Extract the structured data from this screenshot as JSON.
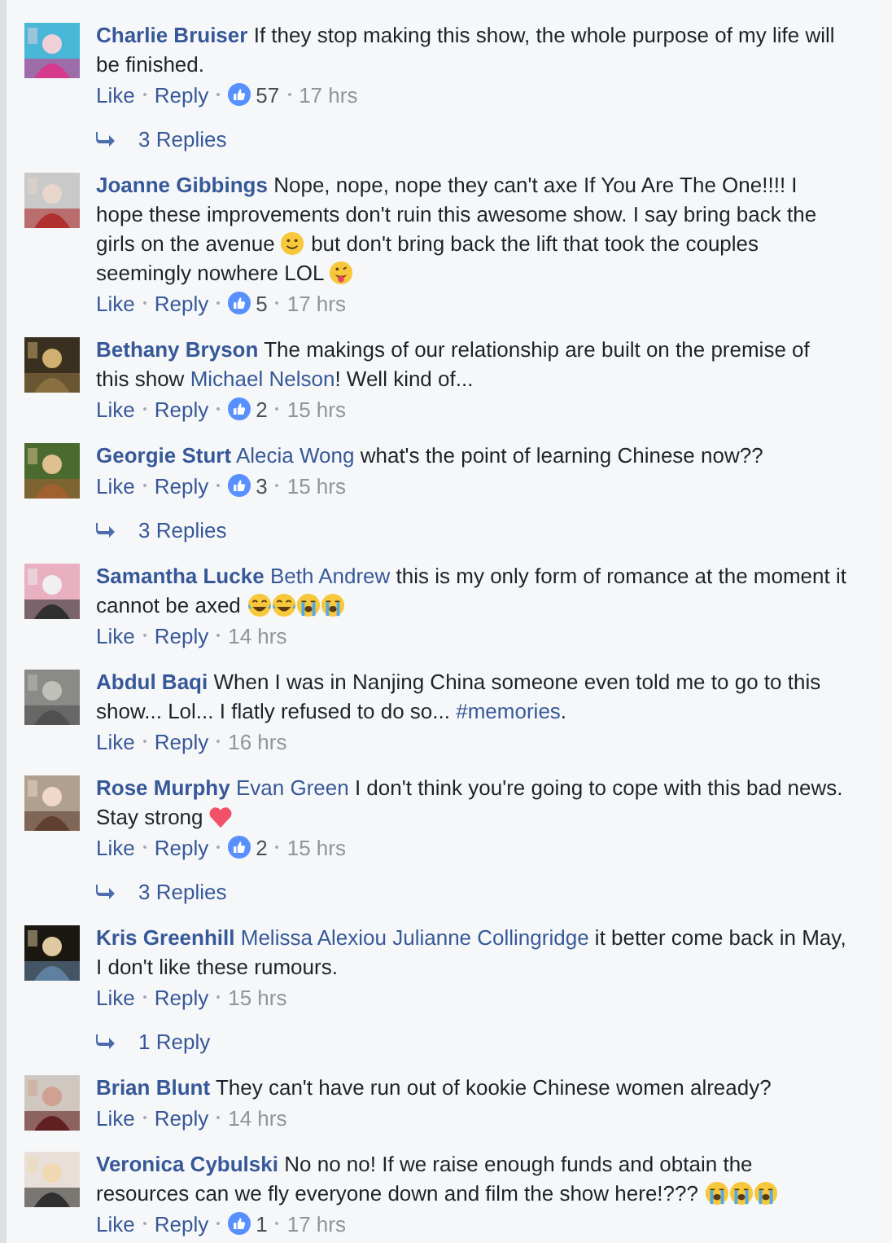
{
  "comments": [
    {
      "author": "Charlie Bruiser",
      "body": [
        {
          "kind": "text",
          "text": "If they stop making this show, the whole purpose of my life will be finished."
        }
      ],
      "actions": [
        "Like",
        "Reply"
      ],
      "likes": "57",
      "time": "17 hrs",
      "replies": "3 Replies"
    },
    {
      "author": "Joanne Gibbings",
      "body": [
        {
          "kind": "text",
          "text": "Nope, nope, nope they can't axe If You Are The One!!!! I hope these improvements don't ruin this awesome show. I say bring back the girls on the avenue "
        },
        {
          "kind": "smile"
        },
        {
          "kind": "text",
          "text": " but don't bring back the lift that took the couples seemingly nowhere LOL "
        },
        {
          "kind": "tongue"
        }
      ],
      "actions": [
        "Like",
        "Reply"
      ],
      "likes": "5",
      "time": "17 hrs"
    },
    {
      "author": "Bethany Bryson",
      "body": [
        {
          "kind": "text",
          "text": "The makings of our relationship are built on the premise of this show "
        },
        {
          "kind": "mention",
          "text": "Michael Nelson"
        },
        {
          "kind": "text",
          "text": "! Well kind of..."
        }
      ],
      "actions": [
        "Like",
        "Reply"
      ],
      "likes": "2",
      "time": "15 hrs"
    },
    {
      "author": "Georgie Sturt",
      "body": [
        {
          "kind": "mention",
          "text": "Alecia Wong"
        },
        {
          "kind": "text",
          "text": " what's the point of learning Chinese now??"
        }
      ],
      "actions": [
        "Like",
        "Reply"
      ],
      "likes": "3",
      "time": "15 hrs",
      "replies": "3 Replies"
    },
    {
      "author": "Samantha Lucke",
      "body": [
        {
          "kind": "mention",
          "text": "Beth Andrew"
        },
        {
          "kind": "text",
          "text": " this is my only form of romance at the moment it cannot be axed "
        },
        {
          "kind": "laugh"
        },
        {
          "kind": "laugh"
        },
        {
          "kind": "sob"
        },
        {
          "kind": "sob"
        }
      ],
      "actions": [
        "Like",
        "Reply"
      ],
      "time": "14 hrs"
    },
    {
      "author": "Abdul Baqi",
      "body": [
        {
          "kind": "text",
          "text": "When I was in Nanjing China someone even told me to go to this show... Lol... I flatly refused to do so... "
        },
        {
          "kind": "mention",
          "text": "#memories"
        },
        {
          "kind": "text",
          "text": "."
        }
      ],
      "actions": [
        "Like",
        "Reply"
      ],
      "time": "16 hrs"
    },
    {
      "author": "Rose Murphy",
      "body": [
        {
          "kind": "mention",
          "text": "Evan Green"
        },
        {
          "kind": "text",
          "text": " I don't think you're going to cope with this bad news. Stay strong "
        },
        {
          "kind": "heart"
        }
      ],
      "actions": [
        "Like",
        "Reply"
      ],
      "likes": "2",
      "time": "15 hrs",
      "replies": "3 Replies"
    },
    {
      "author": "Kris Greenhill",
      "body": [
        {
          "kind": "mention",
          "text": "Melissa Alexiou"
        },
        {
          "kind": "mention",
          "text": "Julianne Collingridge"
        },
        {
          "kind": "text",
          "text": " it better come back in May, I don't like these rumours."
        }
      ],
      "actions": [
        "Like",
        "Reply"
      ],
      "time": "15 hrs",
      "replies": "1 Reply"
    },
    {
      "author": "Brian Blunt",
      "body": [
        {
          "kind": "text",
          "text": "They can't have run out of kookie Chinese women already?"
        }
      ],
      "actions": [
        "Like",
        "Reply"
      ],
      "time": "14 hrs"
    },
    {
      "author": "Veronica Cybulski",
      "body": [
        {
          "kind": "text",
          "text": "No no no! If we raise enough funds and obtain the resources can we fly everyone down and film the show here!??? "
        },
        {
          "kind": "sob"
        },
        {
          "kind": "sob"
        },
        {
          "kind": "sob"
        }
      ],
      "actions": [
        "Like",
        "Reply"
      ],
      "likes": "1",
      "time": "17 hrs"
    }
  ]
}
